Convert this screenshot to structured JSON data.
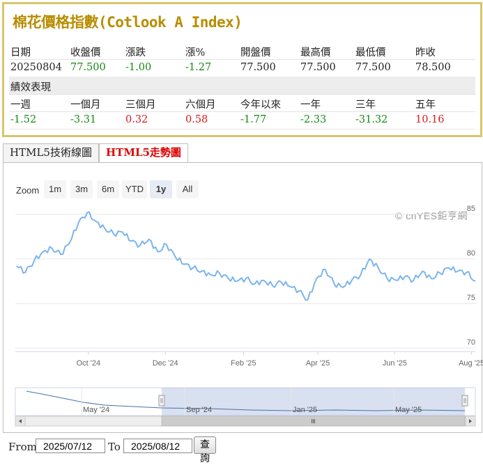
{
  "index": {
    "title": "棉花價格指數(Cotlook A Index)",
    "headers": [
      "日期",
      "收盤價",
      "漲跌",
      "漲%",
      "開盤價",
      "最高價",
      "最低價",
      "昨收"
    ],
    "values": [
      "20250804",
      "77.500",
      "-1.00",
      "-1.27",
      "77.500",
      "77.500",
      "77.500",
      "78.500"
    ],
    "perf_title": "績效表現",
    "perf_headers": [
      "一週",
      "一個月",
      "三個月",
      "六個月",
      "今年以來",
      "一年",
      "三年",
      "五年"
    ],
    "perf_values": [
      "-1.52",
      "-3.31",
      "0.32",
      "0.58",
      "-1.77",
      "-2.33",
      "-31.32",
      "10.16"
    ]
  },
  "tabs": [
    "HTML5技術線圖",
    "HTML5走勢圖"
  ],
  "active_tab": 1,
  "chart": {
    "zoom_label": "Zoom",
    "zoom_buttons": [
      "1m",
      "3m",
      "6m",
      "YTD",
      "1y",
      "All"
    ],
    "zoom_selected": "1y",
    "credit": "© cnYES鉅亨網",
    "line_color": "#7cb5ec"
  },
  "chart_data": {
    "type": "line",
    "title": "",
    "xlabel": "",
    "ylabel": "",
    "ylim": [
      70,
      86
    ],
    "y_ticks": [
      70,
      75,
      80,
      85
    ],
    "x_tick_labels": [
      "Oct '24",
      "Dec '24",
      "Feb '25",
      "Apr '25",
      "Jun '25",
      "Aug '25"
    ],
    "x_tick_dates": [
      "2024-10-01",
      "2024-12-01",
      "2025-02-01",
      "2025-04-01",
      "2025-06-01",
      "2025-08-01"
    ],
    "x_range": [
      "2024-08-04",
      "2025-08-04"
    ],
    "series": [
      {
        "name": "",
        "x": [
          "2024-08-05",
          "2024-08-12",
          "2024-08-19",
          "2024-08-26",
          "2024-09-02",
          "2024-09-09",
          "2024-09-16",
          "2024-09-23",
          "2024-09-30",
          "2024-10-07",
          "2024-10-14",
          "2024-10-21",
          "2024-10-28",
          "2024-11-04",
          "2024-11-11",
          "2024-11-18",
          "2024-11-25",
          "2024-12-02",
          "2024-12-09",
          "2024-12-16",
          "2024-12-23",
          "2024-12-30",
          "2025-01-06",
          "2025-01-13",
          "2025-01-20",
          "2025-01-27",
          "2025-02-03",
          "2025-02-10",
          "2025-02-17",
          "2025-02-24",
          "2025-03-03",
          "2025-03-10",
          "2025-03-17",
          "2025-03-24",
          "2025-03-31",
          "2025-04-07",
          "2025-04-14",
          "2025-04-21",
          "2025-04-28",
          "2025-05-05",
          "2025-05-12",
          "2025-05-19",
          "2025-05-26",
          "2025-06-02",
          "2025-06-09",
          "2025-06-16",
          "2025-06-23",
          "2025-06-30",
          "2025-07-07",
          "2025-07-14",
          "2025-07-21",
          "2025-07-28",
          "2025-08-04"
        ],
        "y": [
          79.2,
          78.5,
          79.8,
          80.8,
          81.2,
          80.5,
          81.8,
          84.0,
          85.2,
          84.2,
          83.4,
          82.8,
          83.0,
          82.0,
          81.5,
          82.2,
          80.8,
          81.6,
          80.2,
          79.4,
          79.0,
          78.6,
          78.2,
          78.4,
          77.8,
          77.5,
          77.8,
          77.2,
          77.6,
          77.0,
          77.4,
          76.9,
          76.4,
          75.4,
          77.8,
          78.8,
          77.2,
          76.8,
          77.6,
          78.2,
          80.0,
          79.0,
          77.8,
          77.6,
          78.0,
          77.6,
          78.6,
          77.8,
          78.4,
          79.0,
          78.6,
          78.5,
          77.5
        ]
      }
    ],
    "navigator_x_labels": [
      "May '24",
      "Sep '24",
      "Jan '25",
      "May '25"
    ]
  },
  "range": {
    "from_label": "From",
    "from_value": "2025/07/12",
    "to_label": "To",
    "to_value": "2025/08/12",
    "query_label": "查詢"
  }
}
